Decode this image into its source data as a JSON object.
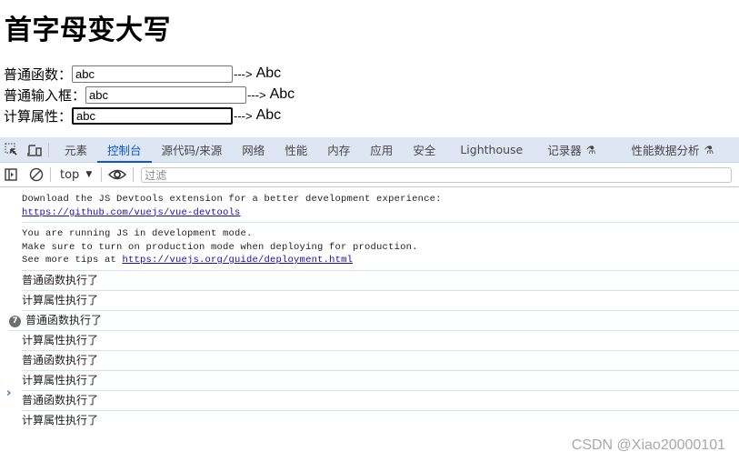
{
  "page": {
    "title": "首字母变大写",
    "rows": [
      {
        "label": "普通函数：",
        "value": "abc",
        "arrow": "--->",
        "output": "Abc"
      },
      {
        "label": "普通输入框：",
        "value": "abc",
        "arrow": "--->",
        "output": "Abc"
      },
      {
        "label": "计算属性：",
        "value": "abc",
        "arrow": "--->",
        "output": "Abc"
      }
    ]
  },
  "devtools": {
    "icons": [
      "inspect-element-icon",
      "device-toolbar-icon"
    ],
    "tabs": [
      {
        "label": "元素",
        "active": false
      },
      {
        "label": "控制台",
        "active": true
      },
      {
        "label": "源代码/来源",
        "active": false
      },
      {
        "label": "网络",
        "active": false
      },
      {
        "label": "性能",
        "active": false
      },
      {
        "label": "内存",
        "active": false
      },
      {
        "label": "应用",
        "active": false
      },
      {
        "label": "安全",
        "active": false
      },
      {
        "label": "Lighthouse",
        "active": false
      },
      {
        "label": "记录器",
        "active": false,
        "experimental": true
      },
      {
        "label": "性能数据分析",
        "active": false,
        "experimental": true
      }
    ],
    "toolbar": {
      "context": "top",
      "filter_placeholder": "过滤"
    },
    "console": {
      "messages": [
        {
          "type": "info",
          "lines": [
            "Download the JS Devtools extension for a better development experience:"
          ],
          "link": "https://github.com/vuejs/vue-devtools"
        },
        {
          "type": "info",
          "lines": [
            "You are running JS in development mode.",
            "Make sure to turn on production mode when deploying for production."
          ],
          "prefix": "See more tips at ",
          "link": "https://vuejs.org/guide/deployment.html"
        }
      ],
      "logs": [
        {
          "text": "普通函数执行了"
        },
        {
          "text": "计算属性执行了"
        },
        {
          "text": "普通函数执行了",
          "count": "7"
        },
        {
          "text": "计算属性执行了"
        },
        {
          "text": "普通函数执行了"
        },
        {
          "text": "计算属性执行了"
        },
        {
          "text": "普通函数执行了"
        },
        {
          "text": "计算属性执行了"
        }
      ],
      "prompt": "›"
    }
  },
  "watermark": "CSDN @Xiao20000101",
  "colors": {
    "accent": "#0b57d0",
    "tabbar_bg": "#dee6f4",
    "link": "#1a0dab",
    "row_separator": "#d3e3f5"
  }
}
